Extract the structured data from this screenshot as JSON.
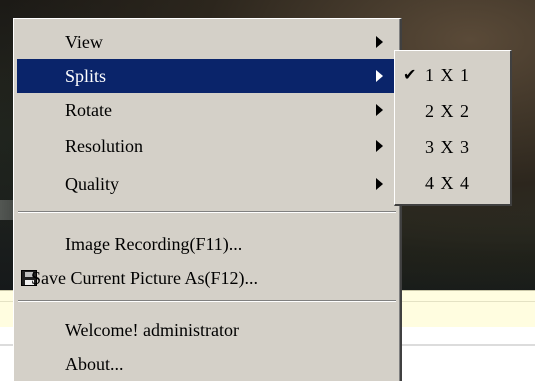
{
  "menu": {
    "items": [
      {
        "label": "View",
        "has_submenu": true,
        "highlighted": false
      },
      {
        "label": "Splits",
        "has_submenu": true,
        "highlighted": true
      },
      {
        "label": "Rotate",
        "has_submenu": true,
        "highlighted": false
      },
      {
        "label": "Resolution",
        "has_submenu": true,
        "highlighted": false
      },
      {
        "label": "Quality",
        "has_submenu": true,
        "highlighted": false
      },
      {
        "label": "Image Recording(F11)...",
        "has_submenu": false
      },
      {
        "label": "Save Current Picture As(F12)...",
        "has_submenu": false,
        "icon": "save-icon"
      },
      {
        "label": "Welcome! administrator",
        "has_submenu": false
      },
      {
        "label": "About...",
        "has_submenu": false
      }
    ]
  },
  "submenu": {
    "items": [
      {
        "label": "1 X 1",
        "checked": true
      },
      {
        "label": "2 X 2",
        "checked": false
      },
      {
        "label": "3 X 3",
        "checked": false
      },
      {
        "label": "4 X 4",
        "checked": false
      }
    ],
    "check_glyph": "✔"
  },
  "colors": {
    "menu_bg": "#d4d0c8",
    "highlight": "#0a246a",
    "status_bg": "#fffde0"
  }
}
